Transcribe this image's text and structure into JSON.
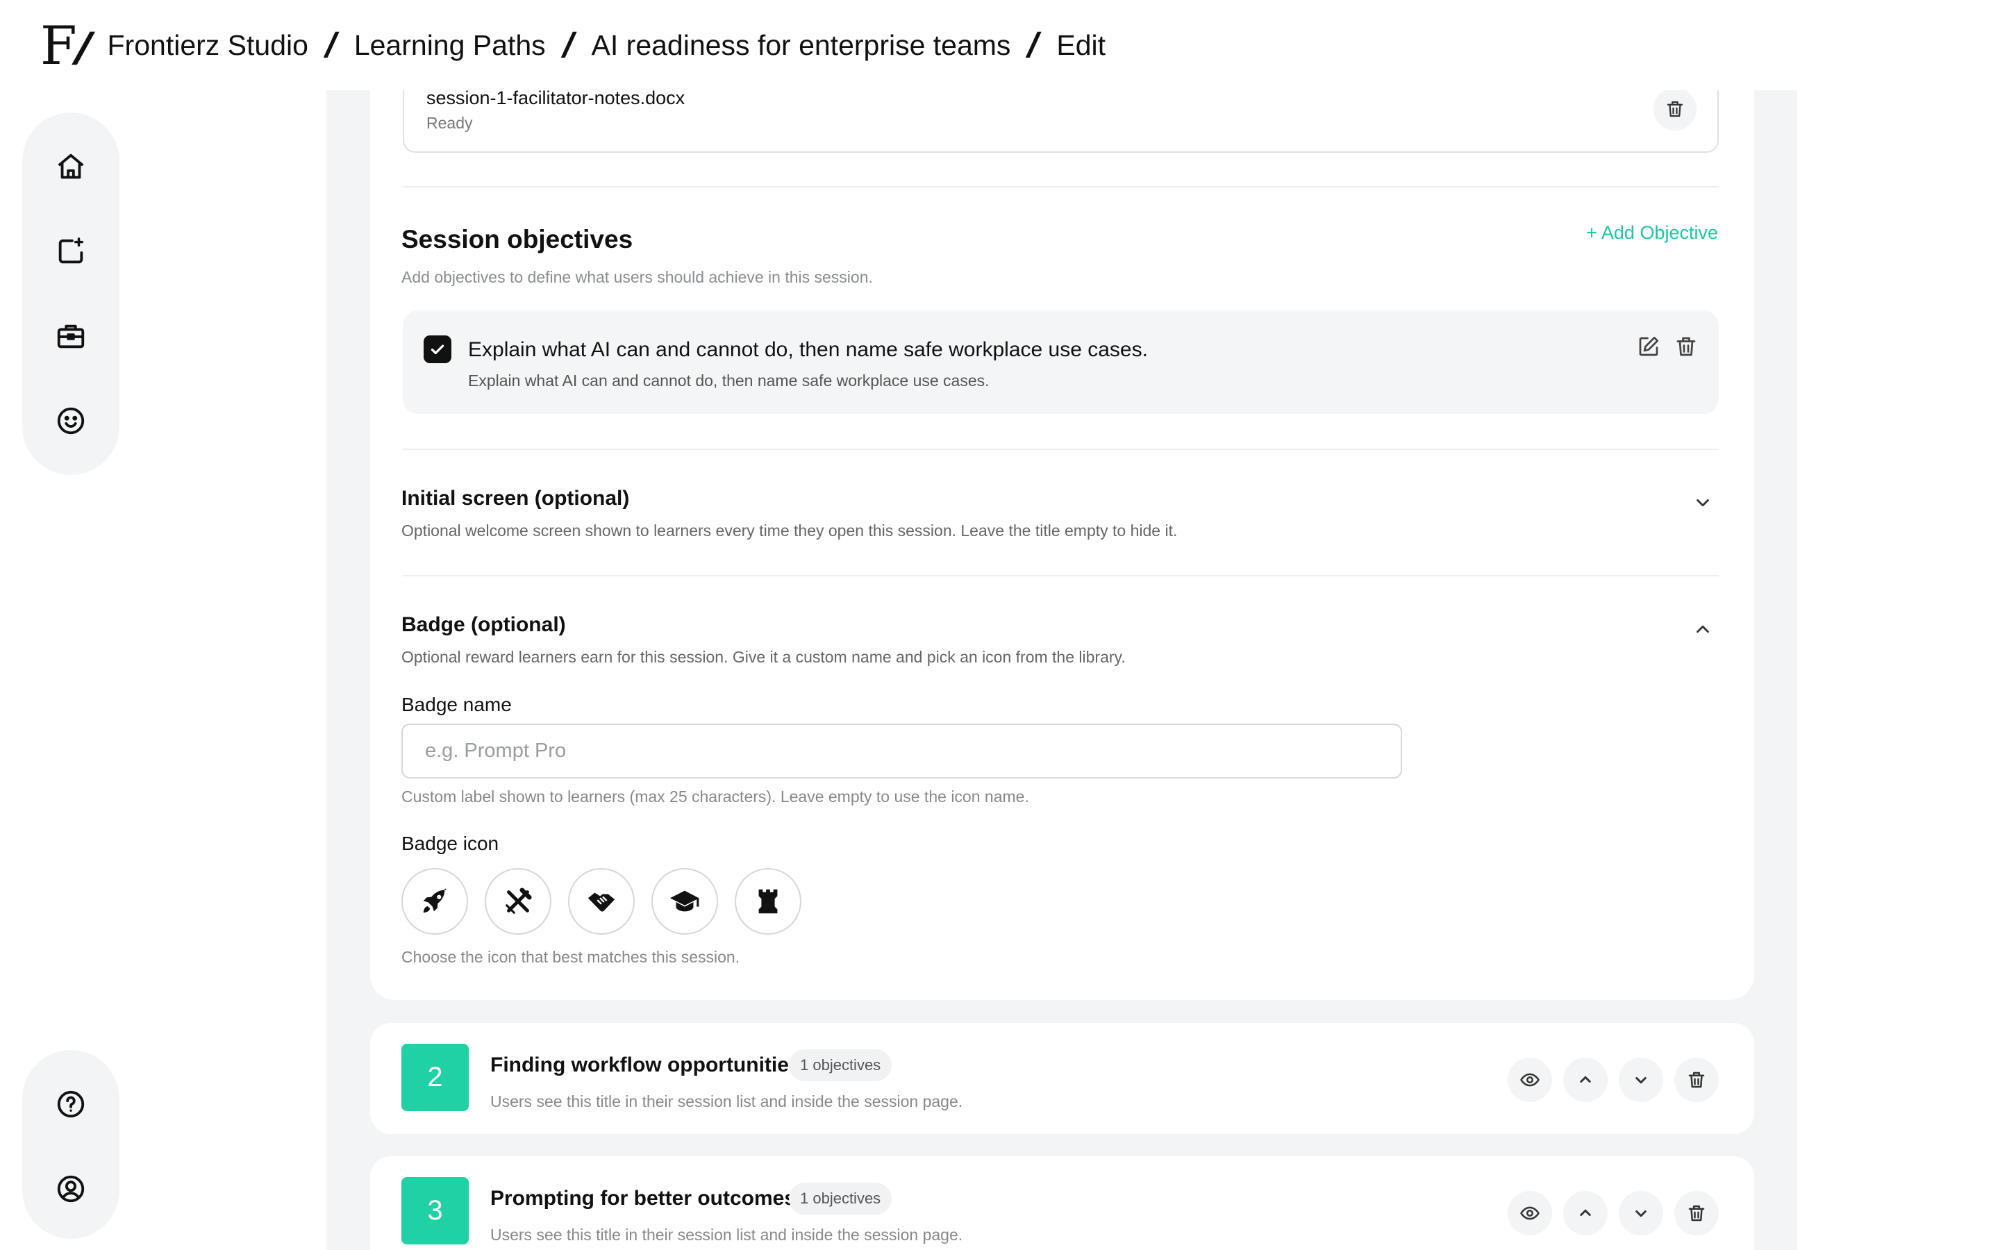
{
  "header": {
    "logo_text": "F",
    "breadcrumbs": [
      "Frontierz Studio",
      "Learning Paths",
      "AI readiness for enterprise teams",
      "Edit"
    ]
  },
  "sidebar": {
    "top_items": [
      "home-icon",
      "new-content-icon",
      "briefcase-icon",
      "smiley-icon"
    ],
    "bottom_items": [
      "help-icon",
      "profile-icon"
    ]
  },
  "file": {
    "name": "session-1-facilitator-notes.docx",
    "status": "Ready"
  },
  "objectives": {
    "title": "Session objectives",
    "subtitle": "Add objectives to define what users should achieve in this session.",
    "add_label": "+ Add Objective",
    "items": [
      {
        "title": "Explain what AI can and cannot do, then name safe workplace use cases.",
        "description": "Explain what AI can and cannot do, then name safe workplace use cases.",
        "checked": true
      }
    ]
  },
  "initial_screen": {
    "title": "Initial screen (optional)",
    "description": "Optional welcome screen shown to learners every time they open this session. Leave the title empty to hide it.",
    "expanded": false
  },
  "badge": {
    "title": "Badge (optional)",
    "description": "Optional reward learners earn for this session. Give it a custom name and pick an icon from the library.",
    "expanded": true,
    "name_label": "Badge name",
    "name_value": "",
    "name_placeholder": "e.g. Prompt Pro",
    "name_help": "Custom label shown to learners (max 25 characters). Leave empty to use the icon name.",
    "icon_label": "Badge icon",
    "icons": [
      "rocket-icon",
      "tools-icon",
      "handshake-icon",
      "graduation-cap-icon",
      "chess-rook-icon"
    ],
    "icon_help": "Choose the icon that best matches this session."
  },
  "sessions": [
    {
      "number": "2",
      "title": "Finding workflow opportunities",
      "badge": "1 objectives",
      "subtitle": "Users see this title in their session list and inside the session page."
    },
    {
      "number": "3",
      "title": "Prompting for better outcomes",
      "badge": "1 objectives",
      "subtitle": "Users see this title in their session list and inside the session page."
    }
  ],
  "colors": {
    "accent": "#1fd1a5",
    "link": "#1cc7a2",
    "backdrop": "#f3f4f5"
  }
}
